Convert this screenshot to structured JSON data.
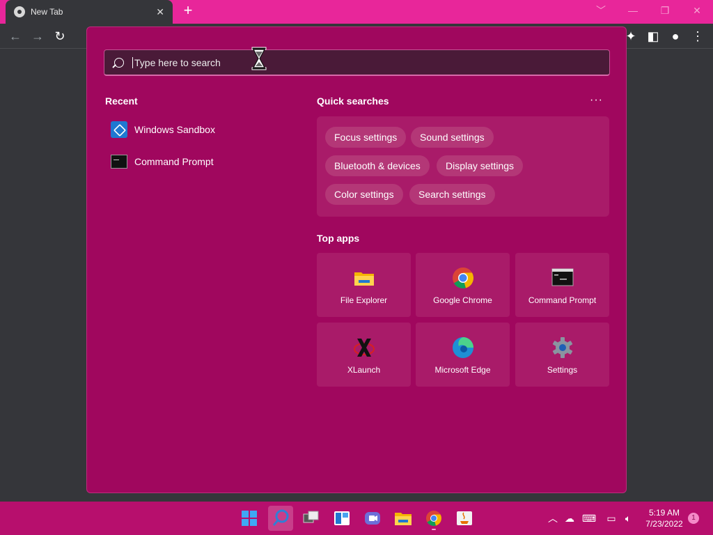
{
  "browser": {
    "tab_title": "New Tab",
    "tab_close": "✕",
    "new_tab": "+",
    "window_controls": [
      "﹀",
      "—",
      "❐",
      "✕"
    ]
  },
  "search": {
    "placeholder": "Type here to search",
    "value": ""
  },
  "recent": {
    "title": "Recent",
    "items": [
      {
        "label": "Windows Sandbox",
        "icon": "windows-sandbox-icon"
      },
      {
        "label": "Command Prompt",
        "icon": "command-prompt-icon"
      }
    ]
  },
  "quick_searches": {
    "title": "Quick searches",
    "more": "···",
    "chips": [
      "Focus settings",
      "Sound settings",
      "Bluetooth & devices",
      "Display settings",
      "Color settings",
      "Search settings"
    ]
  },
  "top_apps": {
    "title": "Top apps",
    "apps": [
      {
        "label": "File Explorer",
        "icon": "folder-icon"
      },
      {
        "label": "Google Chrome",
        "icon": "chrome-icon"
      },
      {
        "label": "Command Prompt",
        "icon": "command-prompt-icon"
      },
      {
        "label": "XLaunch",
        "icon": "x-icon"
      },
      {
        "label": "Microsoft Edge",
        "icon": "edge-icon"
      },
      {
        "label": "Settings",
        "icon": "gear-icon"
      }
    ]
  },
  "taskbar": {
    "time": "5:19 AM",
    "date": "7/23/2022",
    "notification_count": "1"
  },
  "colors": {
    "accent": "#e8269a",
    "panel": "#a0075e",
    "taskbar": "#b70f6d"
  }
}
